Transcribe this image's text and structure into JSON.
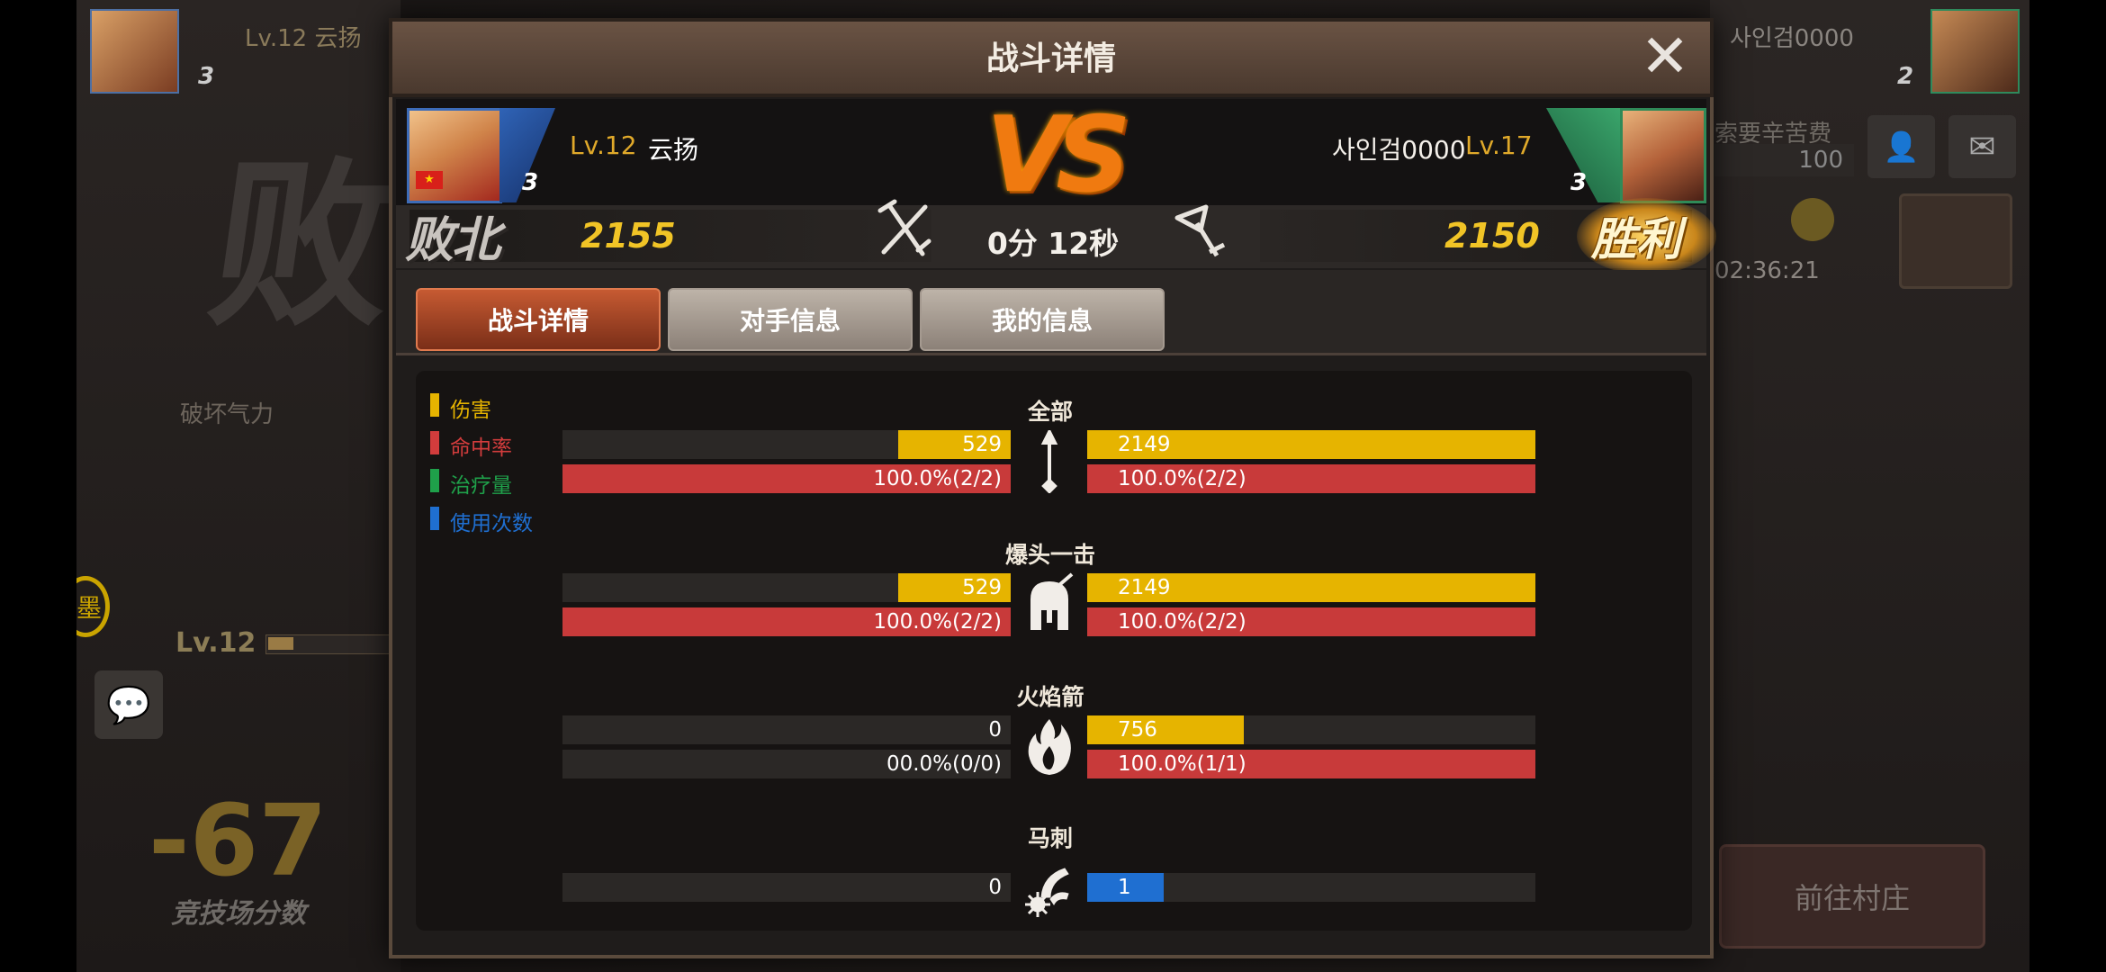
{
  "background": {
    "left_player_name": "Lv.12 云扬",
    "left_stars": "3",
    "right_player_name": "사인검0000",
    "right_stars": "2",
    "defeat_big": "败",
    "destroy_label": "破坏气力",
    "clock_char": "墨",
    "level": "Lv.12",
    "chat_icon": "chat-icon",
    "arena_score": "-67",
    "arena_score_label": "竞技场分数",
    "fee_label": "索要辛苦费",
    "fee_value": "100",
    "timer": "02:36:21",
    "goto_village": "前往村庄"
  },
  "modal": {
    "title": "战斗详情",
    "close_icon": "close-icon",
    "left_player": {
      "level": "Lv.12",
      "name": "云扬",
      "stars": "3",
      "result": "败北",
      "score": "2155",
      "flag": "★"
    },
    "right_player": {
      "level": "Lv.17",
      "name": "사인검0000",
      "stars": "3",
      "result": "胜利",
      "score": "2150"
    },
    "vs": "VS",
    "battle_time": "0分 12秒",
    "tabs": [
      {
        "label": "战斗详情",
        "active": true
      },
      {
        "label": "对手信息",
        "active": false
      },
      {
        "label": "我的信息",
        "active": false
      }
    ],
    "legend": [
      {
        "label": "伤害",
        "color": "#e6b400"
      },
      {
        "label": "命中率",
        "color": "#d23c3c"
      },
      {
        "label": "治疗量",
        "color": "#1fa04a"
      },
      {
        "label": "使用次数",
        "color": "#1f6fd1"
      }
    ],
    "skills": [
      {
        "name": "全部",
        "icon": "arrow-icon",
        "rows": [
          {
            "type": "damage",
            "left": "529",
            "right": "2149",
            "left_frac": 0.25,
            "right_frac": 1.0
          },
          {
            "type": "hit_rate",
            "left": "100.0%(2/2)",
            "right": "100.0%(2/2)",
            "left_frac": 1.0,
            "right_frac": 1.0
          }
        ]
      },
      {
        "name": "爆头一击",
        "icon": "helmet-icon",
        "rows": [
          {
            "type": "damage",
            "left": "529",
            "right": "2149",
            "left_frac": 0.25,
            "right_frac": 1.0
          },
          {
            "type": "hit_rate",
            "left": "100.0%(2/2)",
            "right": "100.0%(2/2)",
            "left_frac": 1.0,
            "right_frac": 1.0
          }
        ]
      },
      {
        "name": "火焰箭",
        "icon": "flame-icon",
        "rows": [
          {
            "type": "damage",
            "left": "0",
            "right": "756",
            "left_frac": 0,
            "right_frac": 0.35
          },
          {
            "type": "hit_rate",
            "left": "00.0%(0/0)",
            "right": "100.0%(1/1)",
            "left_frac": 0,
            "right_frac": 1.0
          }
        ]
      },
      {
        "name": "马刺",
        "icon": "spur-icon",
        "rows": [
          {
            "type": "use_count",
            "left": "0",
            "right": "1",
            "left_frac": 0,
            "right_frac": 0.17
          }
        ]
      }
    ]
  }
}
